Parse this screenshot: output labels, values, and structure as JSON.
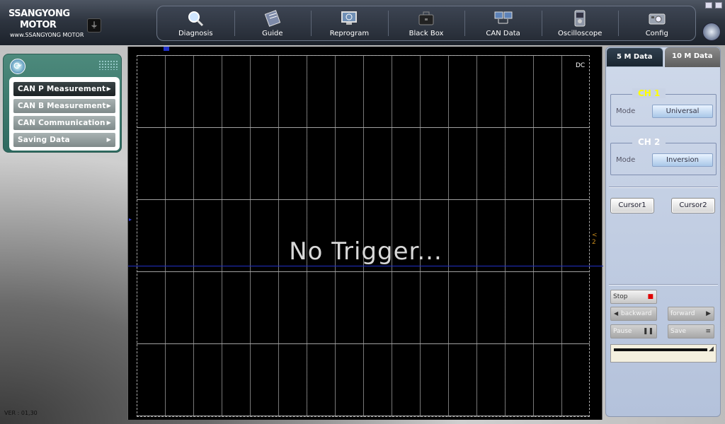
{
  "brand": {
    "line1": "SSANGYONG",
    "line2": "MOTOR",
    "line3": "www.SSANGYONG MOTOR"
  },
  "usb_icon": "usb-icon",
  "nav": [
    {
      "label": "Diagnosis",
      "icon": "magnifier-icon"
    },
    {
      "label": "Guide",
      "icon": "book-icon"
    },
    {
      "label": "Reprogram",
      "icon": "monitor-icon"
    },
    {
      "label": "Black Box",
      "icon": "briefcase-icon"
    },
    {
      "label": "CAN Data",
      "icon": "network-icon"
    },
    {
      "label": "Oscilloscope",
      "icon": "oscilloscope-icon"
    },
    {
      "label": "Config",
      "icon": "camera-icon"
    }
  ],
  "left_menu": {
    "items": [
      {
        "label": "CAN P Measurement",
        "active": true
      },
      {
        "label": "CAN B Measurement",
        "active": false
      },
      {
        "label": "CAN Communication",
        "active": false
      },
      {
        "label": "Saving Data",
        "active": false
      }
    ]
  },
  "version": "VER : 01,30",
  "scope": {
    "status": "No Trigger...",
    "coupling": "DC",
    "ch2_marker": "< 2"
  },
  "right_panel": {
    "tabs": [
      {
        "label": "5 M Data",
        "active": true
      },
      {
        "label": "10 M Data",
        "active": false
      }
    ],
    "ch1": {
      "title": "CH 1",
      "mode_label": "Mode",
      "mode_value": "Universal"
    },
    "ch2": {
      "title": "CH 2",
      "mode_label": "Mode",
      "mode_value": "Inversion"
    },
    "cursor1": "Cursor1",
    "cursor2": "Cursor2",
    "stop": "Stop",
    "backward": "backward",
    "forward": "forward",
    "pause": "Pause",
    "save": "Save"
  },
  "colors": {
    "accent_blue": "#2030c8",
    "ch1_title": "#ffff00",
    "stop_red": "#e00000"
  }
}
